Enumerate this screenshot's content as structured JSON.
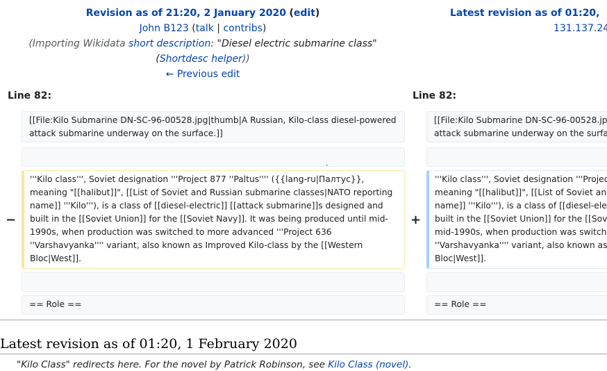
{
  "left_header": {
    "title": "Revision as of 21:20, 2 January 2020",
    "edit": "edit",
    "user": "John B123",
    "talk": "talk",
    "contribs": "contribs",
    "summary_pre": "(Importing Wikidata ",
    "summary_link1": "short description",
    "summary_mid": ": \"Diesel electric submarine class\" (",
    "summary_link2": "Shortdesc helper",
    "summary_post": "))",
    "prev_edit": "← Previous edit"
  },
  "right_header": {
    "title": "Latest revision as of 01:20, ",
    "user": "131.137.24"
  },
  "diff": {
    "left_line": "Line 82:",
    "right_line": "Line 82:",
    "context_1_left": "[[File:Kilo Submarine DN-SC-96-00528.jpg|thumb|A Russian, Kilo-class diesel-powered attack submarine underway on the surface.]]",
    "context_1_right_a": "[[File:Kilo Submarine DN-SC-96-00528.jpg|thumb|A R",
    "context_1_right_b": "attack submarine underway on the surfa",
    "blank_mark": "،",
    "deleted_text": "'''Kilo class''', Soviet designation '''Project 877 ''Paltus'''' ({{lang-ru|Палтус}}, meaning \"[[halibut]]\", [[List of Soviet and Russian submarine classes|NATO reporting name]] '''Kilo'''), is a class of [[diesel-electric]] [[attack submarine]]s designed and built in the [[Soviet Union]] for the [[Soviet Navy]]. It was being produced until mid-1990s, when production was switched to more advanced '''Project 636 ''Varshavyanka'''' variant, also known as Improved Kilo-class by the [[Western Bloc|West]].",
    "added_lines": [
      "'''Kilo class''', Soviet designation '''Project",
      "meaning \"[[halibut]]\", [[List of Soviet and",
      "name]] '''Kilo'''), is a class of [[diesel-ele",
      "built in the [[Soviet Union]] for the [[Sov",
      "mid-1990s, when production was switch",
      "''Varshavyanka'''' variant, also known as",
      "Bloc|West]]."
    ],
    "minus": "−",
    "plus": "+",
    "context_2": "== Role =="
  },
  "article": {
    "heading": "Latest revision as of 01:20, 1 February 2020",
    "hatnote_pre": "\"Kilo Class\" redirects here. For the novel by Patrick Robinson, see ",
    "hatnote_link": "Kilo Class (novel)",
    "hatnote_post": "."
  }
}
